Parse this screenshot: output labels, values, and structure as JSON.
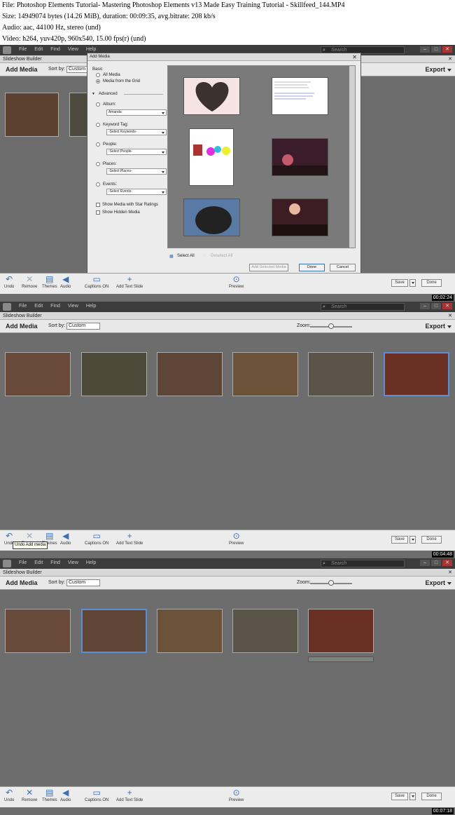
{
  "header": {
    "line1": "File: Photoshop Elements Tutorial- Mastering Photoshop Elements v13 Made Easy Training Tutorial - Skillfeed_144.MP4",
    "line2": "Size: 14949074 bytes (14.26 MiB), duration: 00:09:35, avg.bitrate: 208 kb/s",
    "line3": "Audio: aac, 44100 Hz, stereo (und)",
    "line4": "Video: h264, yuv420p, 960x540, 15.00 fps(r) (und)"
  },
  "app": {
    "menus": [
      "File",
      "Edit",
      "Find",
      "View",
      "Help"
    ],
    "search_placeholder": "Search",
    "window_title": "Slideshow Builder",
    "add_media": "Add Media",
    "sort_by_label": "Sort by:",
    "sort_value": "Custom",
    "zoom_label": "Zoom:",
    "export": "Export",
    "bottom": {
      "undo": "Undo",
      "remove": "Remove",
      "themes": "Themes",
      "audio": "Audio",
      "captions": "Captions ON",
      "add_text_slide": "Add Text Slide",
      "preview": "Preview",
      "save": "Save",
      "done": "Done"
    }
  },
  "frame1": {
    "timestamp": "00:02:24",
    "dialog": {
      "title": "Add Media",
      "basic": "Basic",
      "all_media": "All Media",
      "media_from_grid": "Media from the Grid",
      "advanced": "Advanced",
      "album": "Album:",
      "album_value": "Amanda",
      "keyword_tag": "Keyword Tag:",
      "keyword_value": "-Select Keywords-",
      "people": "People:",
      "people_value": "-Select People-",
      "places": "Places:",
      "places_value": "-Select Places-",
      "events": "Events:",
      "events_value": "-Select Events-",
      "show_star": "Show Media with Star Ratings",
      "show_hidden": "Show Hidden Media",
      "select_all": "Select All",
      "deselect_all": "Deselect All",
      "add_selected": "Add Selected Media",
      "done": "Done",
      "cancel": "Cancel"
    }
  },
  "frame2": {
    "timestamp": "00:04:48",
    "tooltip": "Undo Add media"
  },
  "frame3": {
    "timestamp": "00:07:18"
  },
  "colors": {
    "canvas": "#6d6d6d",
    "selection": "#5a8fd8",
    "icon_blue": "#3a6fb7",
    "menubar": "#3c3c3c"
  }
}
